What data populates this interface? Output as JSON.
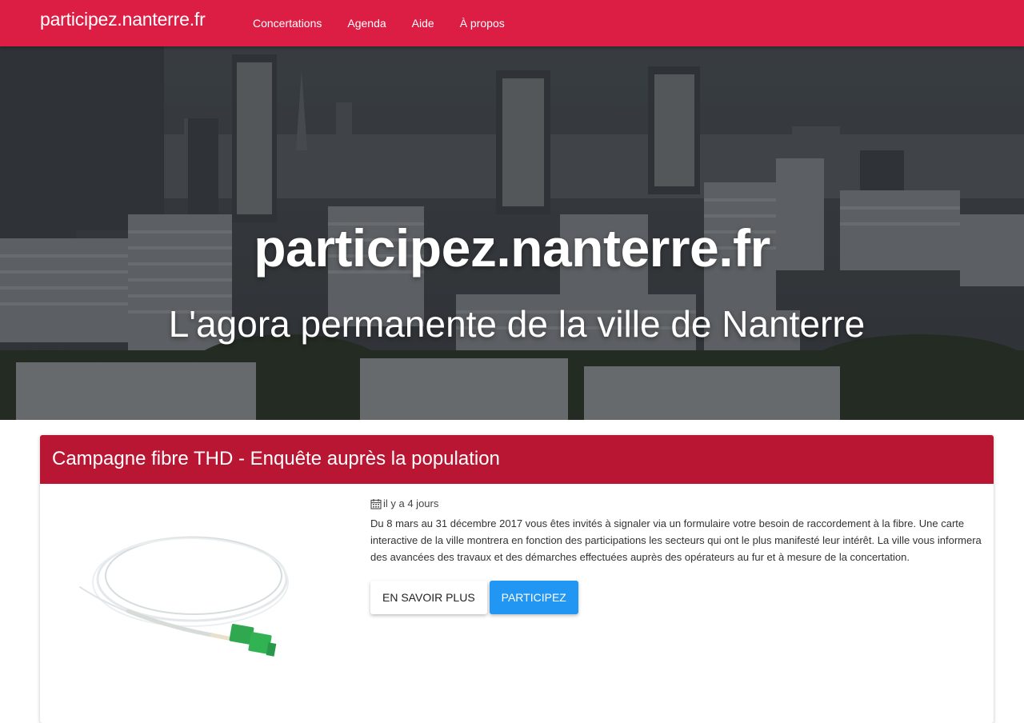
{
  "navbar": {
    "brand": "participez.nanterre.fr",
    "links": [
      "Concertations",
      "Agenda",
      "Aide",
      "À propos"
    ],
    "color": "#dc1d44"
  },
  "hero": {
    "title": "participez.nanterre.fr",
    "subtitle": "L'agora permanente de la ville de Nanterre"
  },
  "card": {
    "title": "Campagne fibre THD - Enquête auprès la population",
    "header_color": "#b81632",
    "date": "il y a 4 jours",
    "description": "Du 8 mars au 31 décembre 2017 vous êtes invités à signaler via un formulaire votre besoin de raccordement à la fibre. Une carte interactive de la ville montrera en fonction des participations les secteurs qui ont le plus manifesté leur intérêt. La ville vous informera des avancées des travaux et des démarches effectuées auprès des opérateurs au fur et à mesure de la concertation.",
    "buttons": {
      "learn_more": "EN SAVOIR PLUS",
      "participate": "PARTICIPEZ"
    },
    "image": "fiber-optic-cable",
    "icon": "calendar-icon",
    "primary_color": "#2196f3"
  }
}
